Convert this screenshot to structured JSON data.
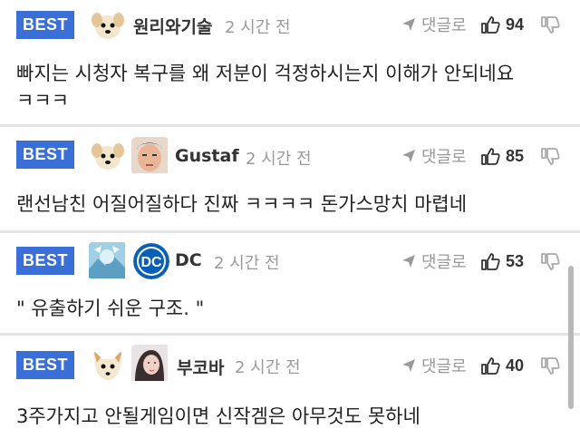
{
  "comments": [
    {
      "badge": "BEST",
      "avatars": [
        "puppy-avatar"
      ],
      "nickname": "원리와기술",
      "time": "2 시간 전",
      "reply_label": "댓글로",
      "likes": "94",
      "lines": [
        "빠지는 시청자 복구를 왜 저분이 걱정하시는지 이해가 안되네요",
        "ㅋㅋㅋ"
      ]
    },
    {
      "badge": "BEST",
      "avatars": [
        "puppy-avatar",
        "face-avatar"
      ],
      "nickname": "Gustaf",
      "time": "2 시간 전",
      "reply_label": "댓글로",
      "likes": "85",
      "lines": [
        "랜선남친 어질어질하다 진짜 ㅋㅋㅋㅋ 돈가스망치 마렵네"
      ]
    },
    {
      "badge": "BEST",
      "avatars": [
        "character-avatar",
        "dc-logo-avatar"
      ],
      "nickname": "DC",
      "time": "2 시간 전",
      "reply_label": "댓글로",
      "likes": "53",
      "lines": [
        "\" 유출하기 쉬운 구조. \""
      ]
    },
    {
      "badge": "BEST",
      "avatars": [
        "fox-avatar",
        "person-avatar"
      ],
      "nickname": "부코바",
      "time": "2 시간 전",
      "reply_label": "댓글로",
      "likes": "40",
      "lines": [
        "3주가지고 안될게임이면 신작겜은 아무것도 못하네"
      ]
    }
  ],
  "colors": {
    "badge": "#3b6fd8",
    "divider": "#e2e4e8",
    "muted": "#9a9a9a"
  },
  "icons": {
    "reply": "paper-plane-icon",
    "like": "thumbs-up-icon",
    "dislike": "thumbs-down-icon"
  }
}
